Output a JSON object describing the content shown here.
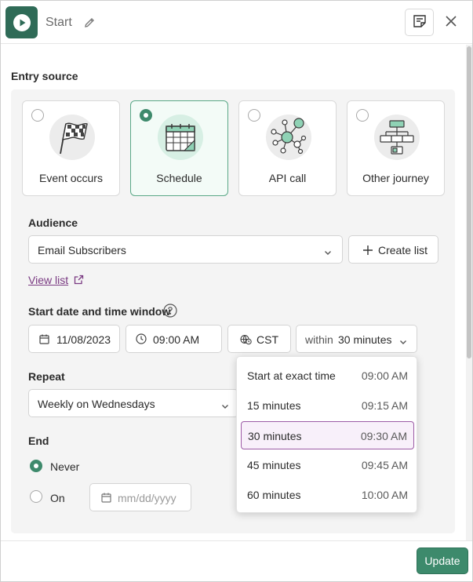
{
  "header": {
    "title": "Start",
    "icons": {
      "start": "play-icon",
      "edit": "pencil-icon",
      "notes": "note-icon",
      "close": "close-icon"
    }
  },
  "entry_source": {
    "title": "Entry source",
    "options": [
      {
        "label": "Event occurs",
        "icon": "checkered-flag-icon",
        "selected": false
      },
      {
        "label": "Schedule",
        "icon": "calendar-icon",
        "selected": true
      },
      {
        "label": "API call",
        "icon": "network-icon",
        "selected": false
      },
      {
        "label": "Other journey",
        "icon": "flowchart-icon",
        "selected": false
      }
    ]
  },
  "audience": {
    "label": "Audience",
    "value": "Email Subscribers",
    "create_label": "Create list",
    "view_link": "View list"
  },
  "schedule": {
    "label": "Start date and time window",
    "date": "11/08/2023",
    "time": "09:00 AM",
    "timezone": "CST",
    "window_prefix": "within",
    "window_value": "30 minutes"
  },
  "window_options": [
    {
      "label": "Start at exact time",
      "time": "09:00 AM",
      "active": false
    },
    {
      "label": "15 minutes",
      "time": "09:15 AM",
      "active": false
    },
    {
      "label": "30 minutes",
      "time": "09:30 AM",
      "active": true
    },
    {
      "label": "45 minutes",
      "time": "09:45 AM",
      "active": false
    },
    {
      "label": "60 minutes",
      "time": "10:00 AM",
      "active": false
    }
  ],
  "repeat": {
    "label": "Repeat",
    "value": "Weekly on Wednesdays"
  },
  "end": {
    "label": "End",
    "never_label": "Never",
    "on_label": "On",
    "date_placeholder": "mm/dd/yyyy",
    "selected": "never"
  },
  "footer": {
    "update_label": "Update"
  },
  "colors": {
    "brand_green": "#3d8a6c",
    "accent_purple": "#7a3a82"
  }
}
